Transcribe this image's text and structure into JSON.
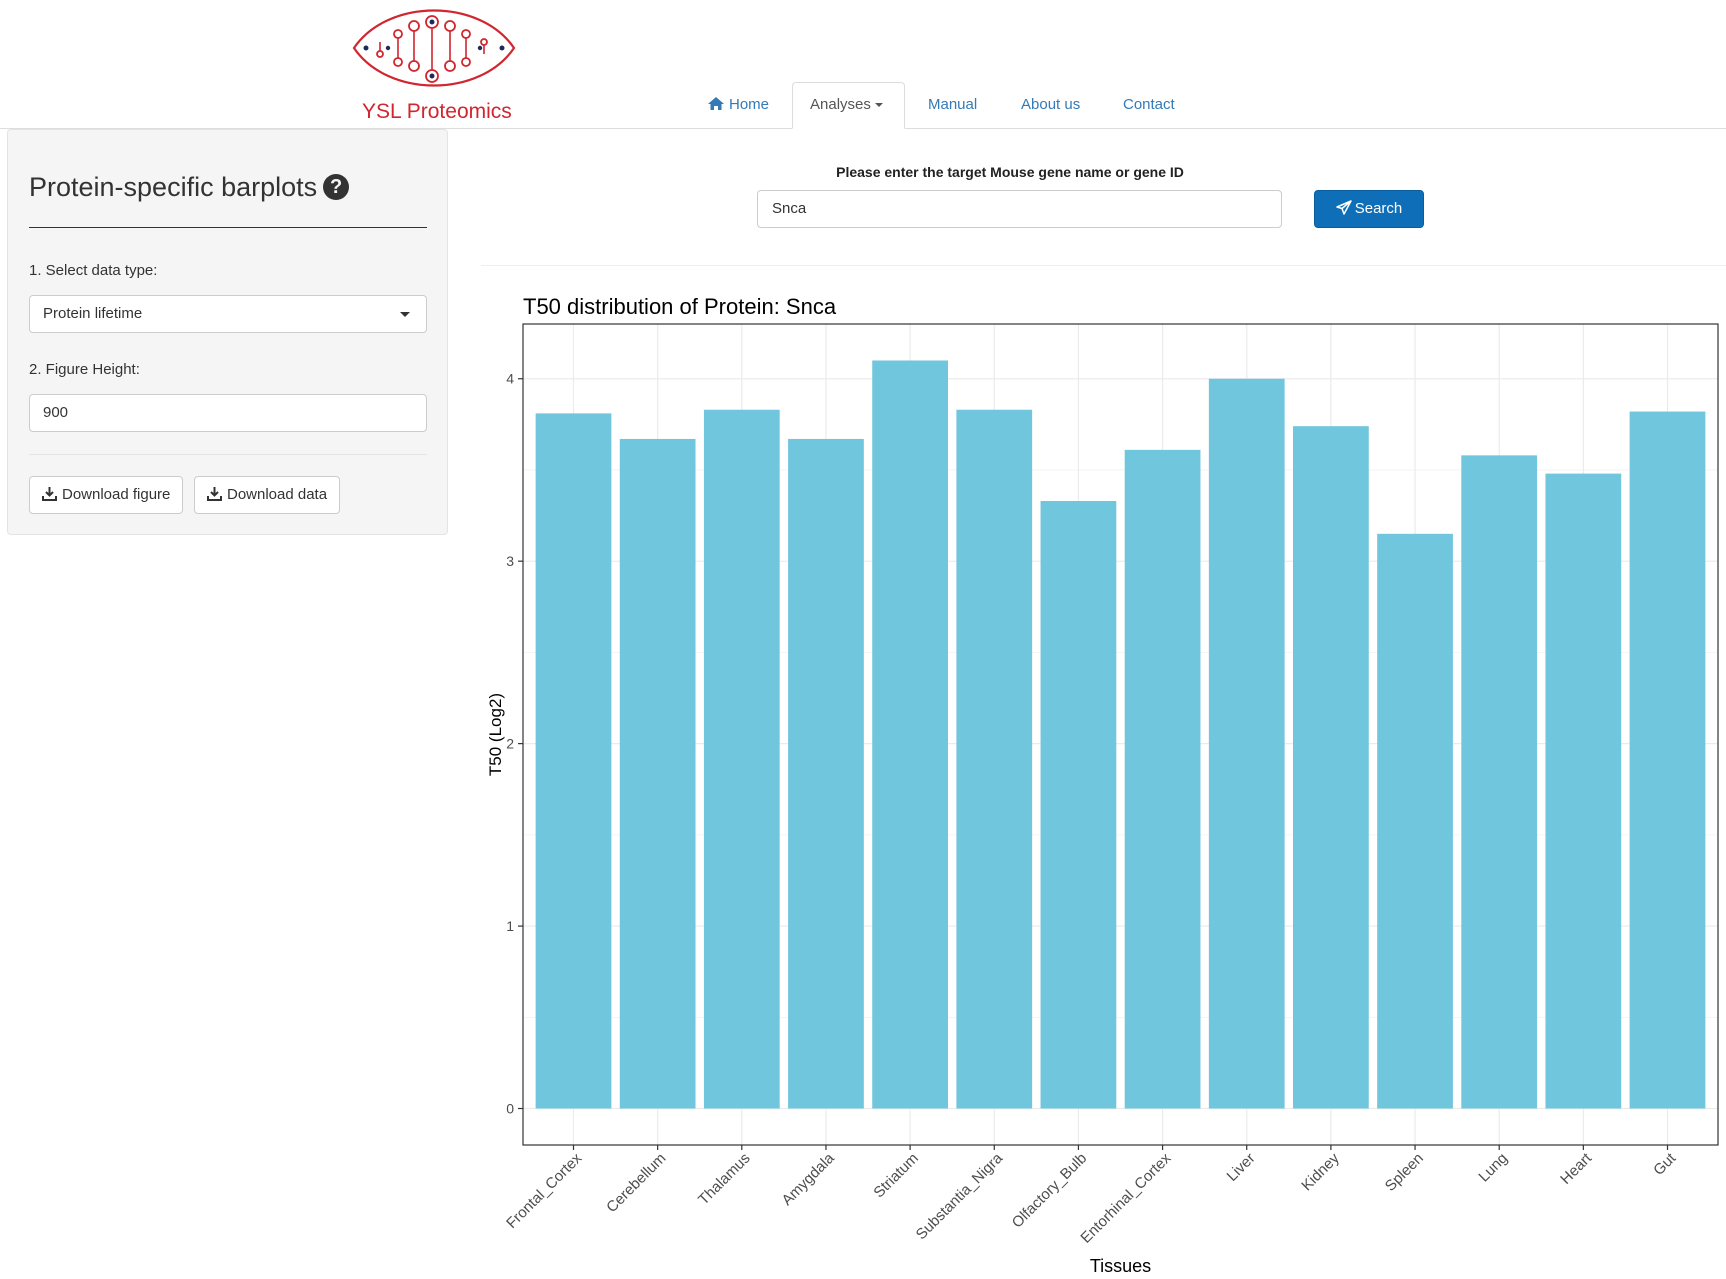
{
  "header": {
    "logo_text": "YSL Proteomics",
    "nav": [
      {
        "label": "Home",
        "icon": "home-icon"
      },
      {
        "label": "Analyses",
        "icon": "caret-down-icon"
      },
      {
        "label": "Manual"
      },
      {
        "label": "About us"
      },
      {
        "label": "Contact"
      }
    ]
  },
  "sidebar": {
    "title": "Protein-specific barplots",
    "help_icon": "question-circle-icon",
    "data_type_label": "1. Select data type:",
    "data_type_value": "Protein lifetime",
    "height_label": "2. Figure Height:",
    "height_value": "900",
    "download_figure_label": "Download figure",
    "download_data_label": "Download data"
  },
  "search": {
    "label": "Please enter the target Mouse gene name or gene ID",
    "value": "Snca",
    "button_label": "Search",
    "button_icon": "paper-plane-icon"
  },
  "colors": {
    "bar": "#70c6dc",
    "brand_red": "#d0262f",
    "link": "#337ab7",
    "search_button": "#0e6fb8"
  },
  "chart_data": {
    "type": "bar",
    "title": "T50 distribution of Protein: Snca",
    "xlabel": "Tissues",
    "ylabel": "T50 (Log2)",
    "categories": [
      "Frontal_Cortex",
      "Cerebellum",
      "Thalamus",
      "Amygdala",
      "Striatum",
      "Substantia_Nigra",
      "Olfactory_Bulb",
      "Entorhinal_Cortex",
      "Liver",
      "Kidney",
      "Spleen",
      "Lung",
      "Heart",
      "Gut"
    ],
    "values": [
      3.81,
      3.67,
      3.83,
      3.67,
      4.1,
      3.83,
      3.33,
      3.61,
      4.0,
      3.74,
      3.15,
      3.58,
      3.48,
      3.82
    ],
    "yticks": [
      0,
      1,
      2,
      3,
      4
    ],
    "ylim": [
      -0.2,
      4.3
    ],
    "grid": true
  }
}
